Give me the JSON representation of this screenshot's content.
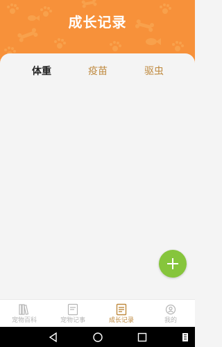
{
  "header": {
    "title": "成长记录",
    "background_color": "#f7913a"
  },
  "tabs": [
    {
      "label": "体重",
      "active": true
    },
    {
      "label": "疫苗",
      "active": false
    },
    {
      "label": "驱虫",
      "active": false
    }
  ],
  "fab": {
    "icon": "plus-icon",
    "color": "#86c53c"
  },
  "bottom_nav": [
    {
      "label": "宠物百科",
      "icon": "book-icon",
      "active": false
    },
    {
      "label": "宠物记事",
      "icon": "notes-icon",
      "active": false
    },
    {
      "label": "成长记录",
      "icon": "record-icon",
      "active": true
    },
    {
      "label": "我的",
      "icon": "profile-icon",
      "active": false
    }
  ],
  "colors": {
    "accent": "#bf8a3f",
    "inactive": "#b5b5b5"
  }
}
